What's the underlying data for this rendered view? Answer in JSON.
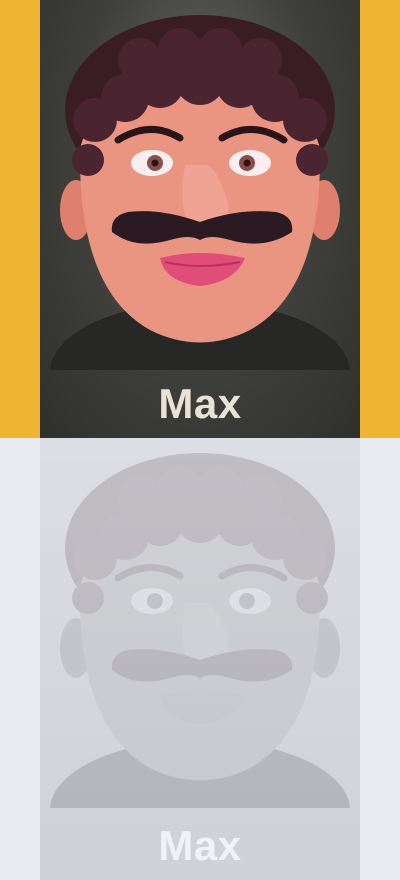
{
  "cards": [
    {
      "name": "Max",
      "state": "selected"
    },
    {
      "name": "Max",
      "state": "faded"
    }
  ],
  "colors": {
    "background_top": "#efb431",
    "background_bottom": "#e9ebf1",
    "card_dark": "#3e3f3b",
    "skin": "#e98f7c",
    "hair": "#3a1d24",
    "lips": "#e04d78"
  },
  "icons": [
    "character-portrait-max"
  ]
}
